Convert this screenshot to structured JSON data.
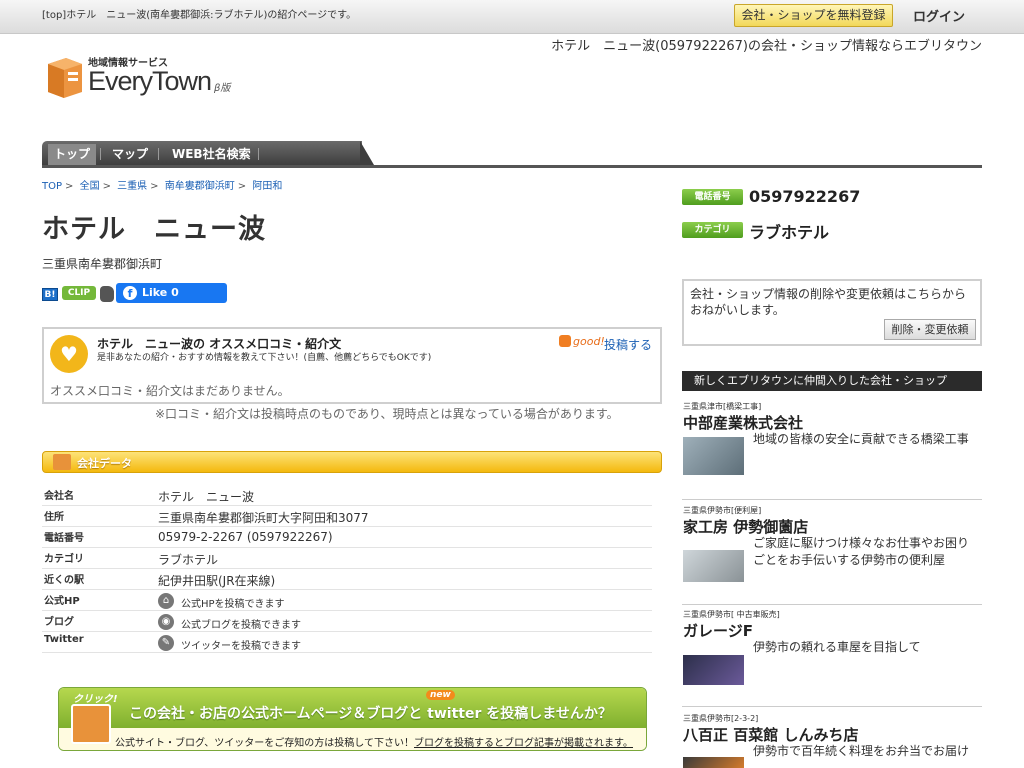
{
  "topbar": {
    "crumb_text": "[top]ホテル　ニュー波(南牟婁郡御浜:ラブホテル)の紹介ページです。",
    "register_label": "会社・ショップを無料登録",
    "login_label": "ログイン"
  },
  "header": {
    "tagline": "ホテル　ニュー波(0597922267)の会社・ショップ情報ならエブリタウン",
    "logo_sub": "地域情報サービス",
    "logo_main": "EveryTown",
    "logo_beta": "β版"
  },
  "nav": {
    "items": [
      "トップ",
      "マップ",
      "WEB社名検索"
    ]
  },
  "breadcrumb": [
    "TOP",
    "全国",
    "三重県",
    "南牟婁郡御浜町",
    "阿田和"
  ],
  "page": {
    "title": "ホテル　ニュー波",
    "address": "三重県南牟婁郡御浜町"
  },
  "social": {
    "hatena": "B!",
    "clip": "CLIP",
    "fb_like": "Like 0",
    "fb_f": "f"
  },
  "reviews": {
    "title": "ホテル　ニュー波の オススメ口コミ・紹介文",
    "subtitle": "是非あなたの紹介・おすすめ情報を教えて下さい！(自薦、他薦どちらでもOKです)",
    "good": "good!",
    "post_label": "投稿する",
    "empty": "オススメ口コミ・紹介文はまだありません。",
    "note": "※口コミ・紹介文は投稿時点のものであり、現時点とは異なっている場合があります。"
  },
  "company": {
    "heading": "会社データ",
    "rows": [
      {
        "key": "会社名",
        "value": "ホテル　ニュー波"
      },
      {
        "key": "住所",
        "value": "三重県南牟婁郡御浜町大字阿田和3077"
      },
      {
        "key": "電話番号",
        "value": "05979-2-2267 (0597922267)"
      },
      {
        "key": "カテゴリ",
        "value": "ラブホテル"
      },
      {
        "key": "近くの駅",
        "value": "紀伊井田駅(JR在来線)"
      },
      {
        "key": "公式HP",
        "value": "公式HPを投稿できます"
      },
      {
        "key": "ブログ",
        "value": "公式ブログを投稿できます"
      },
      {
        "key": "Twitter",
        "value": "ツイッターを投稿できます"
      }
    ]
  },
  "banner": {
    "click": "クリック!",
    "new": "new",
    "message": "この会社・お店の公式ホームページ＆ブログと twitter を投稿しませんか？",
    "sub": "公式サイト・ブログ、ツイッターをご存知の方は投稿して下さい！",
    "sub_link": "ブログを投稿するとブログ記事が掲載されます。"
  },
  "sidebar": {
    "phone_label": "電話番号",
    "phone": "0597922267",
    "category_label": "カテゴリ",
    "category": "ラブホテル",
    "request_text": "会社・ショップ情報の削除や変更依頼はこちらからおねがいします。",
    "request_button": "削除・変更依頼",
    "new_heading": "新しくエブリタウンに仲間入りした会社・ショップ",
    "companies": [
      {
        "loc": "三重県津市[橋梁工事]",
        "name": "中部産業株式会社",
        "desc": "地域の皆様の安全に貢献できる橋梁工事"
      },
      {
        "loc": "三重県伊勢市[便利屋]",
        "name": "家工房 伊勢御薗店",
        "desc": "ご家庭に駆けつけ様々なお仕事やお困りごとをお手伝いする伊勢市の便利屋"
      },
      {
        "loc": "三重県伊勢市[ 中古車販売]",
        "name": "ガレージF",
        "desc": "伊勢市の頼れる車屋を目指して"
      },
      {
        "loc": "三重県伊勢市[2-3-2]",
        "name": "八百正 百菜館 しんみち店",
        "desc": "伊勢市で百年続く料理をお弁当でお届け"
      }
    ]
  },
  "colors": {
    "accent_green": "#74b83a",
    "accent_yellow": "#f4b90e",
    "link_blue": "#1a5fb4"
  }
}
